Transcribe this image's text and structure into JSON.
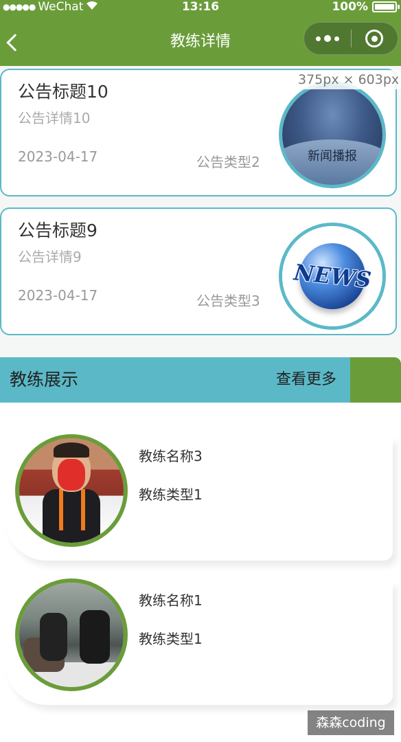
{
  "status_bar": {
    "carrier": "WeChat",
    "time": "13:16",
    "battery": "100%"
  },
  "nav": {
    "title": "教练详情"
  },
  "overlay": {
    "size_label": "375px × 603px"
  },
  "notices": [
    {
      "title": "公告标题10",
      "detail": "公告详情10",
      "date": "2023-04-17",
      "type": "公告类型2",
      "image_label": "新闻播报"
    },
    {
      "title": "公告标题9",
      "detail": "公告详情9",
      "date": "2023-04-17",
      "type": "公告类型3",
      "image_label": "NEWS"
    }
  ],
  "coach_section": {
    "title": "教练展示",
    "more_label": "查看更多"
  },
  "coaches": [
    {
      "name": "教练名称3",
      "type": "教练类型1"
    },
    {
      "name": "教练名称1",
      "type": "教练类型1"
    }
  ],
  "watermark": "森森coding",
  "colors": {
    "primary_green": "#6a9d3a",
    "accent_teal": "#5bb9c7"
  }
}
